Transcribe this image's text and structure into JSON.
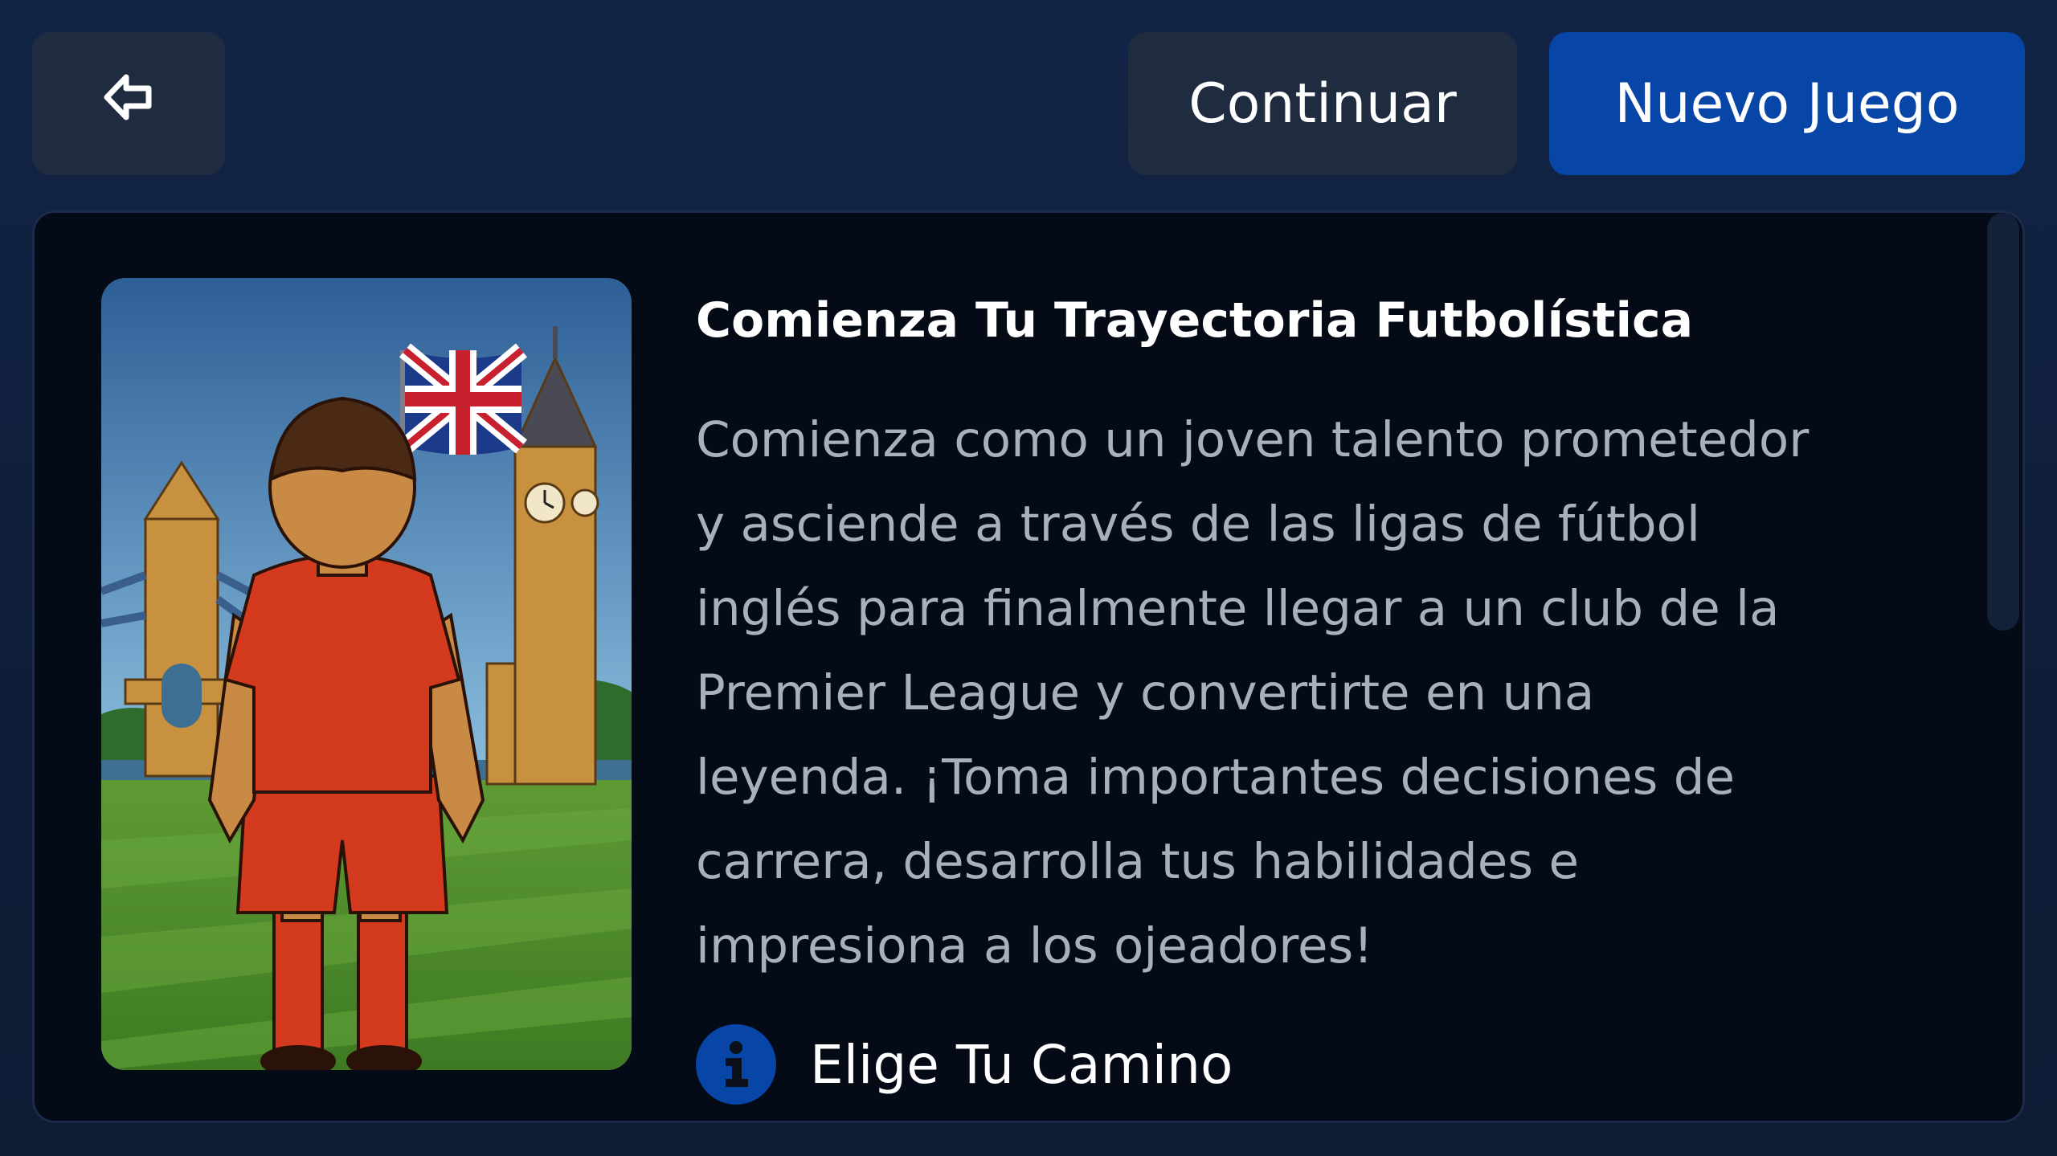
{
  "topbar": {
    "back_icon": "arrow-left-icon",
    "continue_label": "Continuar",
    "new_game_label": "Nuevo Juego"
  },
  "card": {
    "title": "Comienza Tu Trayectoria Futbolística",
    "description_lines": [
      "Comienza como un joven talento prometedor",
      "y asciende a través de las ligas de fútbol",
      "inglés para finalmente llegar a un club de la",
      "Premier League y convertirte en una",
      "leyenda. ¡Toma importantes decisiones de",
      "carrera, desarrolla tus habilidades e",
      "impresiona a los ojeadores!"
    ],
    "section": {
      "icon": "info-icon",
      "label": "Elige Tu Camino"
    }
  },
  "colors": {
    "background": "#0f1f3d",
    "card_background": "#050a17",
    "button_dark": "#1f2b3f",
    "accent": "#0745a6",
    "description_text": "#aab0bb"
  }
}
